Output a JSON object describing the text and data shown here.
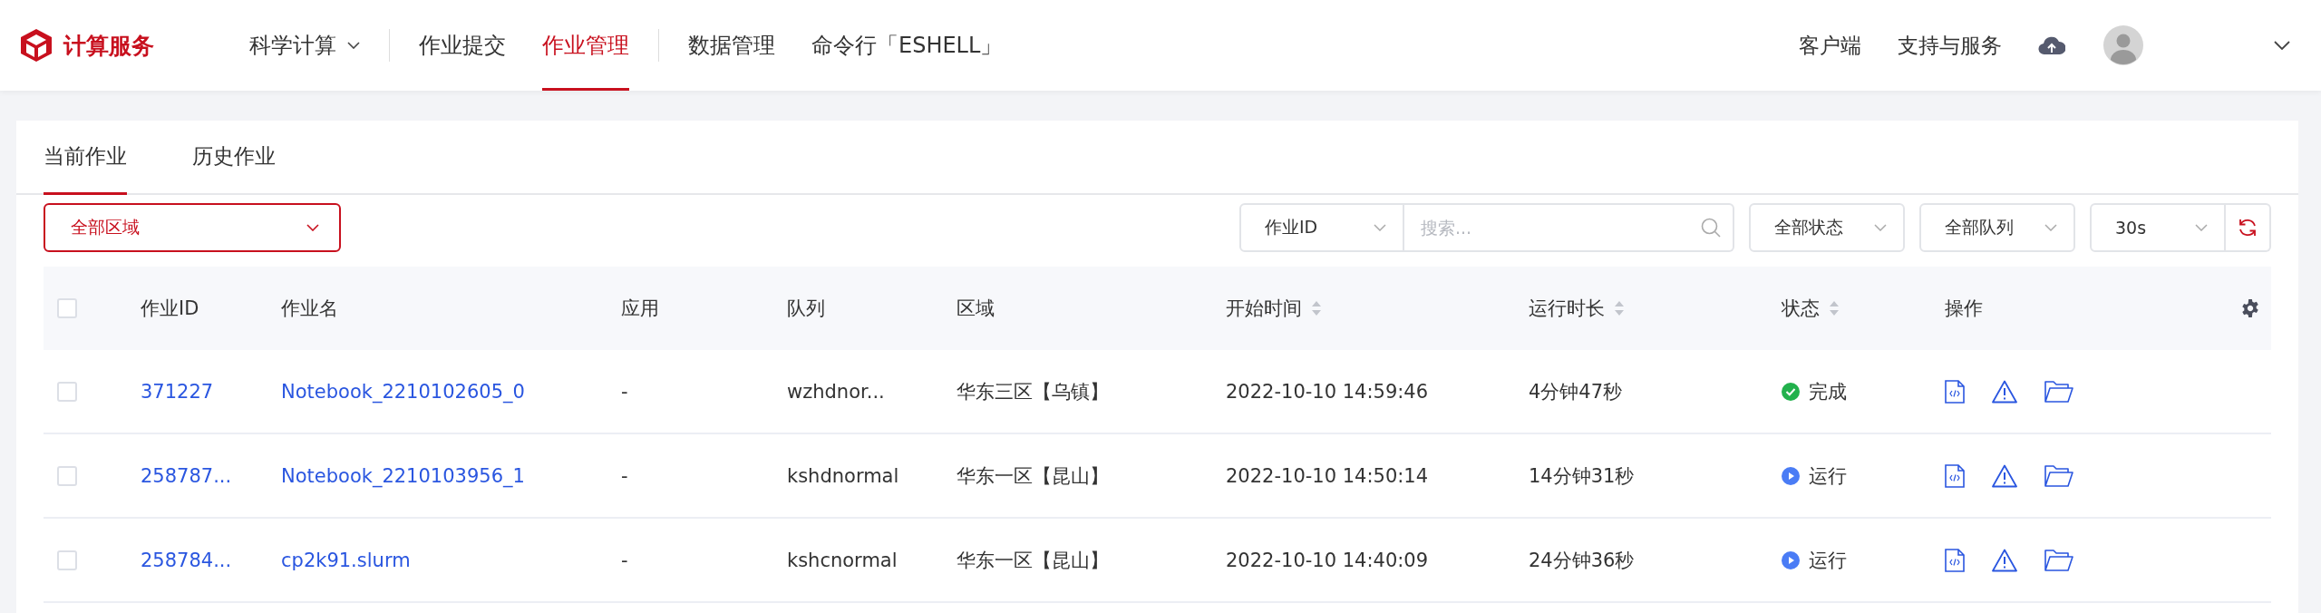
{
  "header": {
    "logo": "计算服务",
    "nav": [
      {
        "label": "科学计算",
        "selected": false,
        "dropdown": true
      },
      {
        "label": "作业提交",
        "selected": false,
        "dropdown": false
      },
      {
        "label": "作业管理",
        "selected": true,
        "dropdown": false
      },
      {
        "label": "数据管理",
        "selected": false,
        "dropdown": false
      },
      {
        "label": "命令行「ESHELL」",
        "selected": false,
        "dropdown": false
      }
    ],
    "right_links": [
      "客户端",
      "支持与服务"
    ]
  },
  "tabs": [
    {
      "label": "当前作业",
      "selected": true
    },
    {
      "label": "历史作业",
      "selected": false
    }
  ],
  "filters": {
    "region": "全部区域",
    "search_by": "作业ID",
    "search": {
      "placeholder": "搜索..."
    },
    "status": "全部状态",
    "queue": "全部队列",
    "refresh_interval": "30s"
  },
  "table": {
    "select_all": {
      "checked": false
    },
    "columns": [
      {
        "label": "作业ID",
        "sortable": false
      },
      {
        "label": "作业名",
        "sortable": false
      },
      {
        "label": "应用",
        "sortable": false
      },
      {
        "label": "队列",
        "sortable": false
      },
      {
        "label": "区域",
        "sortable": false
      },
      {
        "label": "开始时间",
        "sortable": true
      },
      {
        "label": "运行时长",
        "sortable": true
      },
      {
        "label": "状态",
        "sortable": true
      },
      {
        "label": "操作",
        "sortable": false
      }
    ],
    "rows": [
      {
        "checked": false,
        "id": "371227",
        "name": "Notebook_2210102605_0",
        "app": "-",
        "queue": "wzhdnor...",
        "region": "华东三区【乌镇】",
        "start": "2022-10-10 14:59:46",
        "duration": "4分钟47秒",
        "status": {
          "label": "完成",
          "kind": "done"
        }
      },
      {
        "checked": false,
        "id": "258787...",
        "name": "Notebook_2210103956_1",
        "app": "-",
        "queue": "kshdnormal",
        "region": "华东一区【昆山】",
        "start": "2022-10-10 14:50:14",
        "duration": "14分钟31秒",
        "status": {
          "label": "运行",
          "kind": "running"
        }
      },
      {
        "checked": false,
        "id": "258784...",
        "name": "cp2k91.slurm",
        "app": "-",
        "queue": "kshcnormal",
        "region": "华东一区【昆山】",
        "start": "2022-10-10 14:40:09",
        "duration": "24分钟36秒",
        "status": {
          "label": "运行",
          "kind": "running"
        }
      }
    ]
  }
}
